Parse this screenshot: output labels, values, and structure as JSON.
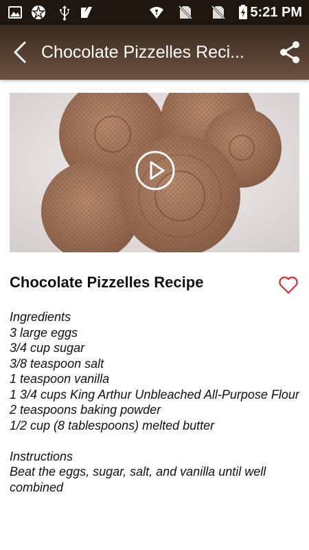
{
  "status_bar": {
    "time": "5:21 PM",
    "icons": [
      "image-icon",
      "app-icon",
      "usb-icon",
      "download-check-icon",
      "wifi-icon",
      "sim-off-icon",
      "sim-off-icon",
      "battery-charging-icon"
    ]
  },
  "app_bar": {
    "title": "Chocolate Pizzelles Reci...",
    "back_icon": "back-icon",
    "share_icon": "share-icon",
    "color": "#4a372a"
  },
  "media": {
    "play_icon": "play-icon"
  },
  "recipe": {
    "title": "Chocolate Pizzelles Recipe",
    "favorite_icon": "heart-icon",
    "favorite_color": "#d32f2f",
    "content": "Ingredients\n3 large eggs\n3/4 cup sugar\n3/8 teaspoon salt\n1 teaspoon vanilla\n1 3/4 cups King Arthur Unbleached All-Purpose Flour\n2 teaspoons baking powder\n1/2 cup (8 tablespoons) melted butter\n\nInstructions\nBeat the eggs, sugar, salt, and vanilla until well combined"
  }
}
